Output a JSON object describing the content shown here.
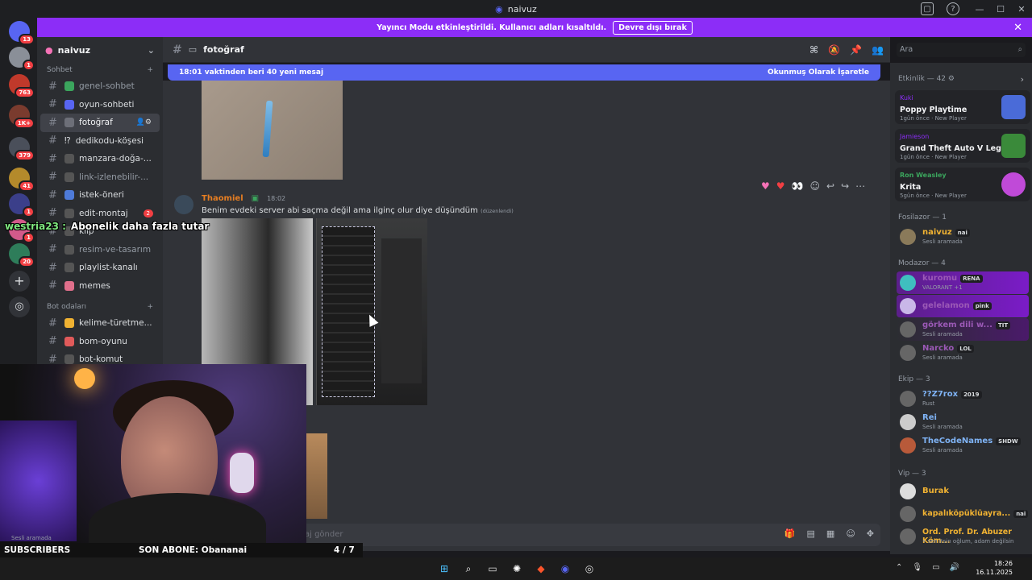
{
  "window": {
    "title": "naivuz"
  },
  "banner": {
    "text": "Yayıncı Modu etkinleştirildi. Kullanıcı adları kısaltıldı.",
    "button": "Devre dışı bırak"
  },
  "guild_badges": [
    "13",
    "1",
    "763",
    "1K+",
    "379",
    "41",
    "1",
    "1",
    "20"
  ],
  "server": {
    "name": "naivuz"
  },
  "categories": {
    "sohbet": "Sohbet",
    "bot": "Bot odaları"
  },
  "channels": [
    {
      "label": "genel-sohbet",
      "muted": true
    },
    {
      "label": "oyun-sohbeti"
    },
    {
      "label": "fotoğraf",
      "active": true
    },
    {
      "label": "dedikodu-köşesi",
      "prefix": "⁉"
    },
    {
      "label": "manzara-doğa-..."
    },
    {
      "label": "link-izlenebilir-...",
      "muted": true
    },
    {
      "label": "istek-öneri"
    },
    {
      "label": "edit-montaj",
      "badge": "2"
    },
    {
      "label": "klip"
    },
    {
      "label": "resim-ve-tasarım",
      "muted": true
    },
    {
      "label": "playlist-kanalı"
    },
    {
      "label": "memes"
    }
  ],
  "bot_channels": [
    {
      "label": "kelime-türetme..."
    },
    {
      "label": "bom-oyunu"
    },
    {
      "label": "bot-komut"
    }
  ],
  "channel_header": {
    "name": "fotoğraf"
  },
  "search": {
    "placeholder": "Ara"
  },
  "new_messages": {
    "text": "18:01 vaktinden beri 40 yeni mesaj",
    "action": "Okunmuş Olarak İşaretle"
  },
  "message": {
    "author": "Thaomiel",
    "time": "18:02",
    "text": "Benim evdeki server abi saçma değil ama ilginç olur diye düşündüm",
    "edited": "(düzenlendi)"
  },
  "input": {
    "placeholder": "aj gönder"
  },
  "members": {
    "activity_header": "Etkinlik — 42",
    "activities": [
      {
        "user": "Kuki",
        "game": "Poppy Playtime",
        "meta": "1gün önce",
        "tag": "New Player",
        "art": "#2b7ae0"
      },
      {
        "user": "Jamieson",
        "game": "Grand Theft Auto V Legacy",
        "meta": "1gün önce",
        "tag": "New Player",
        "art": "#3a8a3a"
      },
      {
        "user": "Ron Weasley",
        "game": "Krita",
        "meta": "5gün önce",
        "tag": "New Player",
        "art": "#c04ad8"
      }
    ],
    "group_fosilazor": "Fosilazor — 1",
    "group_modazor": "Modazor — 4",
    "group_ekip": "Ekip — 3",
    "group_vip": "Vip — 3",
    "list": [
      {
        "name": "naivuz",
        "tag": "nai",
        "status": "Sesli aramada",
        "color": "#f0b232"
      },
      {
        "name": "kuromu",
        "tag": "RENA",
        "status": "VALORANT +1",
        "color": "#9b59b6"
      },
      {
        "name": "gelelamon",
        "tag": "pink",
        "status": "",
        "color": "#9b59b6"
      },
      {
        "name": "görkem dili w...",
        "tag": "TIT",
        "status": "Sesli aramada",
        "color": "#9b59b6"
      },
      {
        "name": "Narcko",
        "tag": "LOL",
        "status": "Sesli aramada",
        "color": "#9b59b6"
      },
      {
        "name": "??Z7rox",
        "tag": "2019",
        "status": "Rust",
        "color": "#7fb3f5"
      },
      {
        "name": "Rei",
        "tag": "",
        "status": "Sesli aramada",
        "color": "#7fb3f5"
      },
      {
        "name": "TheCodeNames",
        "tag": "SHDW",
        "status": "Sesli aramada",
        "color": "#7fb3f5"
      },
      {
        "name": "Burak",
        "tag": "",
        "status": "",
        "color": "#f0b232"
      },
      {
        "name": "kapalıköpüklüayra...",
        "tag": "nai",
        "status": "",
        "color": "#f0b232"
      },
      {
        "name": "Ord. Prof. Dr. Abuzer Köm...",
        "tag": "",
        "status": "• sen itsin oğlum, adam değilsin",
        "color": "#f0b232"
      }
    ]
  },
  "overlay": {
    "subtitle_user": "westria23 :",
    "subtitle_text": "Abonelik daha fazla tutar",
    "goal_label": "SUBSCRIBERS",
    "last_sub": "SON ABONE: Obananai",
    "goal_count": "4  / 7",
    "goal_progress": 0.57,
    "voice_status": "Sesli aramada"
  },
  "taskbar": {
    "time": "18:26",
    "date": "16.11.2025"
  }
}
